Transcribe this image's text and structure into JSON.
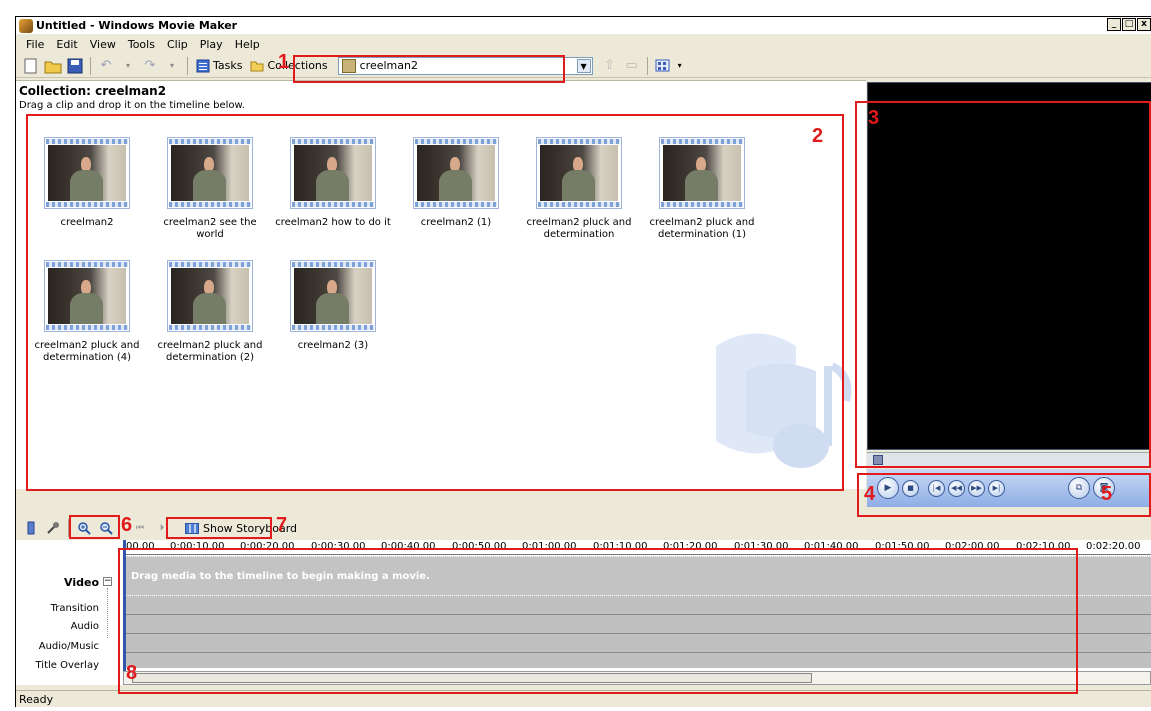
{
  "window": {
    "title": "Untitled - Windows Movie Maker",
    "buttons": [
      "_",
      "□",
      "x"
    ]
  },
  "menu": [
    "File",
    "Edit",
    "View",
    "Tools",
    "Clip",
    "Play",
    "Help"
  ],
  "toolbar": {
    "tasks_label": "Tasks",
    "collections_label": "Collections",
    "collection_select_value": "creelman2"
  },
  "collection": {
    "title": "Collection: creelman2",
    "subtitle": "Drag a clip and drop it on the timeline below.",
    "clips": [
      {
        "label": "creelman2"
      },
      {
        "label": "creelman2 see the world"
      },
      {
        "label": "creelman2 how to do it"
      },
      {
        "label": "creelman2 (1)"
      },
      {
        "label": "creelman2 pluck and determination"
      },
      {
        "label": "creelman2 pluck and determination (1)"
      },
      {
        "label": "creelman2 pluck and determination (4)"
      },
      {
        "label": "creelman2 pluck and determination (2)"
      },
      {
        "label": "creelman2 (3)"
      }
    ]
  },
  "timeline_toolbar": {
    "storyboard_label": "Show Storyboard"
  },
  "timeline": {
    "ruler": [
      "00.00",
      "0:00:10.00",
      "0:00:20.00",
      "0:00:30.00",
      "0:00:40.00",
      "0:00:50.00",
      "0:01:00.00",
      "0:01:10.00",
      "0:01:20.00",
      "0:01:30.00",
      "0:01:40.00",
      "0:01:50.00",
      "0:02:00.00",
      "0:02:10.00",
      "0:02:20.00"
    ],
    "tracks": {
      "video": "Video",
      "transition": "Transition",
      "audio": "Audio",
      "audio_music": "Audio/Music",
      "title_overlay": "Title Overlay"
    },
    "video_hint": "Drag media to the timeline to begin making a movie."
  },
  "status": "Ready",
  "annotations": [
    "1",
    "2",
    "3",
    "4",
    "5",
    "6",
    "7",
    "8"
  ],
  "colors": {
    "annotation": "#e11b1b",
    "window_bg": "#ece9d8",
    "preview_bg": "#000000"
  }
}
